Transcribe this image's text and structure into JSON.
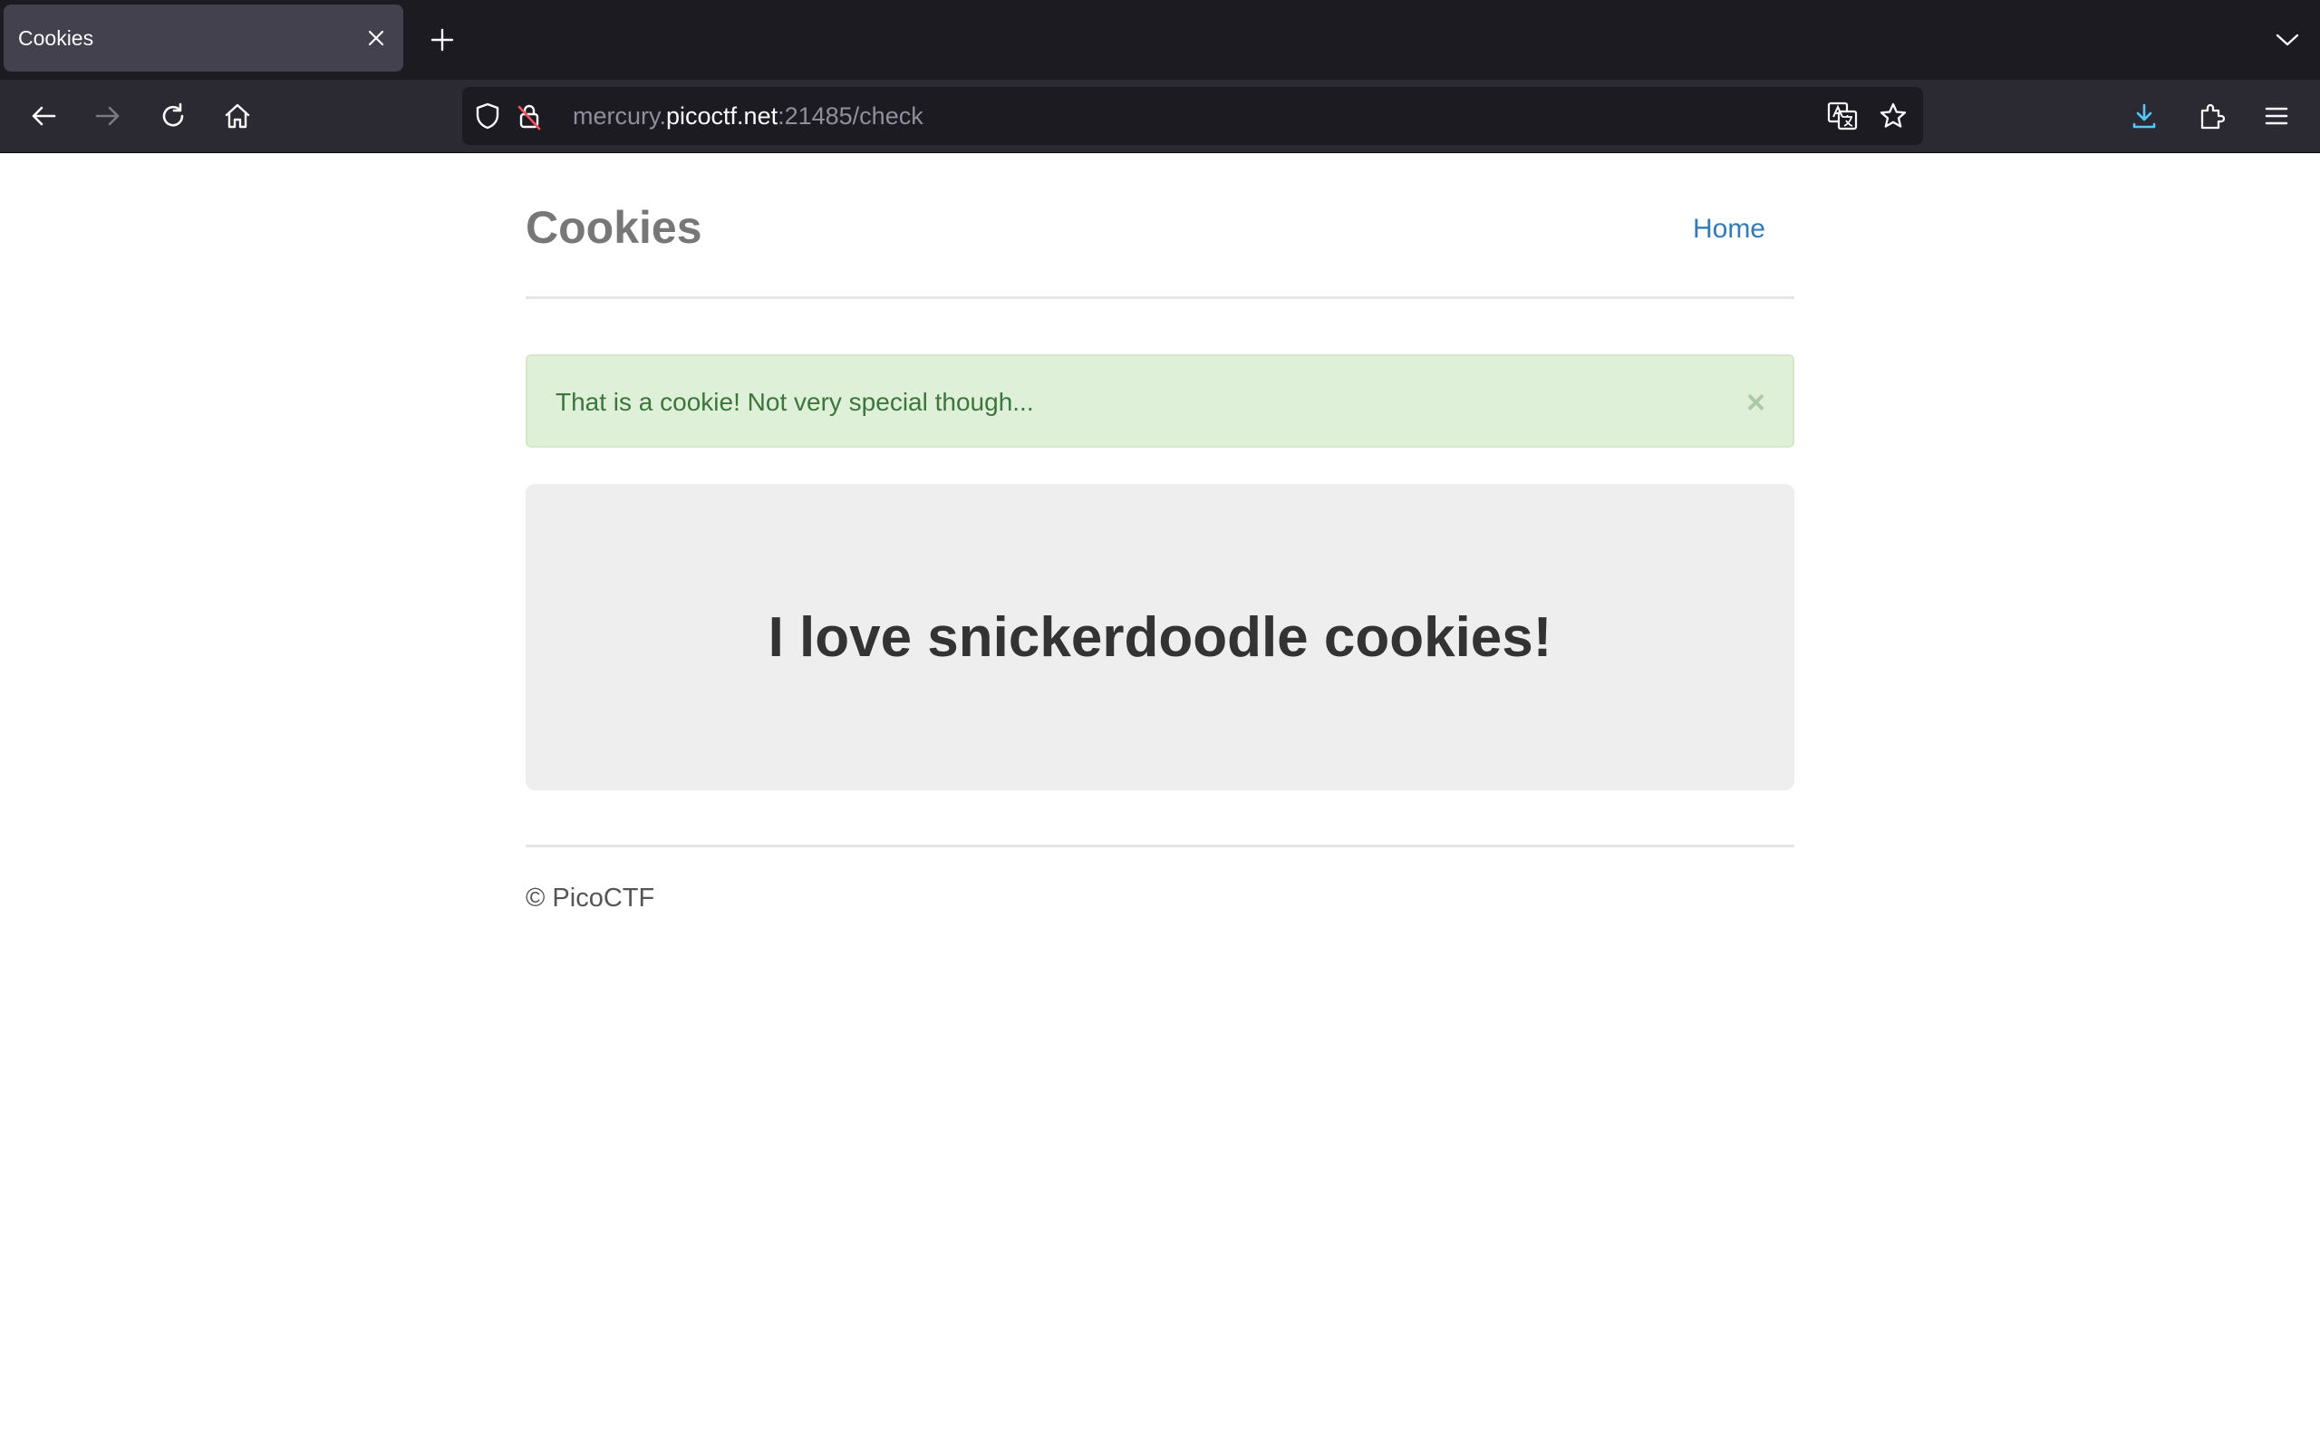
{
  "browser": {
    "tab_title": "Cookies",
    "url_subdomain": "mercury.",
    "url_host": "picoctf.net",
    "url_rest": ":21485/check"
  },
  "site": {
    "brand": "Cookies",
    "nav_home": "Home"
  },
  "alert": {
    "message": "That is a cookie! Not very special though...",
    "close_label": "×"
  },
  "jumbotron": {
    "heading": "I love snickerdoodle cookies!"
  },
  "footer": {
    "text": "© PicoCTF"
  },
  "colors": {
    "link": "#337ab7",
    "alert_bg": "#dff0d8",
    "alert_text": "#3c763d",
    "jumbotron_bg": "#eeeeee",
    "download_accent": "#54ffbd"
  }
}
